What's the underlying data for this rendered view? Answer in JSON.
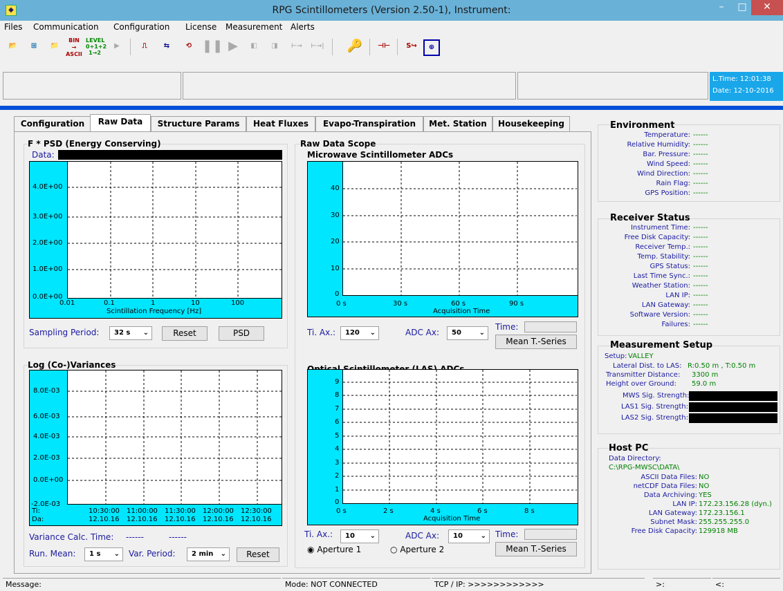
{
  "window": {
    "title": "RPG Scintillometers (Version 2.50-1), Instrument:",
    "minimize": "–",
    "maximize": "□",
    "close": "✕"
  },
  "menu": [
    "Files",
    "Communication",
    "Configuration",
    "License",
    "Measurement",
    "Alerts"
  ],
  "toolbar": {
    "bin_ascii": "BIN\nASCII",
    "level": "LEVEL\n0+1+2\n1→2"
  },
  "clock": {
    "time": "L.Time: 12:01:38",
    "date": "Date: 12-10-2016"
  },
  "tabs": [
    "Configuration",
    "Raw Data",
    "Structure Params",
    "Heat Fluxes",
    "Evapo-Transpiration",
    "Met. Station",
    "Housekeeping"
  ],
  "psd": {
    "title": "F * PSD (Energy Conserving)",
    "data_label": "Data:",
    "y_ticks": [
      "4.0E+00",
      "3.0E+00",
      "2.0E+00",
      "1.0E+00",
      "0.0E+00"
    ],
    "x_ticks": [
      "0.01",
      "0.1",
      "1",
      "10",
      "100"
    ],
    "xlabel": "Scintillation Frequency [Hz]",
    "sampling_label": "Sampling Period:",
    "sampling_value": "32 s",
    "reset": "Reset",
    "psd_button": "PSD"
  },
  "scope": {
    "title": "Raw Data Scope",
    "mw_title": "Microwave Scintillometer ADCs",
    "mw_y_ticks": [
      "40",
      "30",
      "20",
      "10",
      "0"
    ],
    "mw_x_ticks": [
      "0 s",
      "30 s",
      "60 s",
      "90 s"
    ],
    "xlabel": "Acquisition Time",
    "ti_ax_label": "Ti. Ax.:",
    "mw_ti_value": "120",
    "adc_ax_label": "ADC Ax:",
    "mw_adc_value": "50",
    "time_label": "Time:",
    "mean_button": "Mean T.-Series",
    "las_title": "Optical Scintillometer (LAS) ADCs",
    "las_y_ticks": [
      "9",
      "8",
      "7",
      "6",
      "5",
      "4",
      "3",
      "2",
      "1",
      "0"
    ],
    "las_x_ticks": [
      "0 s",
      "2 s",
      "4 s",
      "6 s",
      "8 s"
    ],
    "las_ti_value": "10",
    "las_adc_value": "10",
    "aperture1": "Aperture 1",
    "aperture2": "Aperture 2"
  },
  "logvar": {
    "title": "Log (Co-)Variances",
    "y_ticks": [
      "8.0E-03",
      "6.0E-03",
      "4.0E-03",
      "2.0E-03",
      "0.0E+00",
      "-2.0E-03"
    ],
    "ti_label": "Ti:",
    "da_label": "Da:",
    "x_times": [
      "10:30:00",
      "11:00:00",
      "11:30:00",
      "12:00:00",
      "12:30:00"
    ],
    "x_dates": [
      "12.10.16",
      "12.10.16",
      "12.10.16",
      "12.10.16",
      "12.10.16"
    ],
    "calc_label": "Variance Calc. Time:",
    "calc_value1": "------",
    "calc_value2": "------",
    "run_mean_label": "Run. Mean:",
    "run_mean_value": "1 s",
    "var_period_label": "Var. Period:",
    "var_period_value": "2 min",
    "reset": "Reset"
  },
  "environment": {
    "title": "Environment",
    "rows": [
      {
        "k": "Temperature:",
        "v": "------"
      },
      {
        "k": "Relative Humidity:",
        "v": "------"
      },
      {
        "k": "Bar. Pressure:",
        "v": "------"
      },
      {
        "k": "Wind Speed:",
        "v": "------"
      },
      {
        "k": "Wind Direction:",
        "v": "------"
      },
      {
        "k": "Rain Flag:",
        "v": "------"
      },
      {
        "k": "GPS Position:",
        "v": "------"
      }
    ]
  },
  "receiver": {
    "title": "Receiver Status",
    "rows": [
      {
        "k": "Instrument Time:",
        "v": "------"
      },
      {
        "k": "Free Disk Capacity:",
        "v": "------"
      },
      {
        "k": "Receiver Temp.:",
        "v": "------"
      },
      {
        "k": "Temp. Stability:",
        "v": "------"
      },
      {
        "k": "GPS Status:",
        "v": "------"
      },
      {
        "k": "Last Time Sync.:",
        "v": "------"
      },
      {
        "k": "Weather Station:",
        "v": "------"
      },
      {
        "k": "LAN IP:",
        "v": "------"
      },
      {
        "k": "LAN Gateway:",
        "v": "------"
      },
      {
        "k": "Software Version:",
        "v": "------"
      },
      {
        "k": "Failures:",
        "v": "------"
      }
    ]
  },
  "setup": {
    "title": "Measurement Setup",
    "setup_label": "Setup:",
    "setup_value": "VALLEY",
    "lat_label": "Lateral Dist. to LAS:",
    "lat_value": "R:0.50 m , T:0.50 m",
    "tx_label": "Transmitter Distance:",
    "tx_value": "3300 m",
    "height_label": "Height over Ground:",
    "height_value": "59.0 m",
    "mws_label": "MWS Sig. Strength:",
    "las1_label": "LAS1 Sig. Strength:",
    "las2_label": "LAS2 Sig. Strength:"
  },
  "host": {
    "title": "Host PC",
    "dir_label": "Data Directory:",
    "dir_value": "C:\\RPG-MWSC\\DATA\\",
    "rows": [
      {
        "k": "ASCII Data Files:",
        "v": "NO"
      },
      {
        "k": "netCDF Data Files:",
        "v": "NO"
      },
      {
        "k": "Data Archiving:",
        "v": "YES"
      },
      {
        "k": "LAN IP:",
        "v": "172.23.156.28 (dyn.)"
      },
      {
        "k": "LAN Gateway:",
        "v": "172.23.156.1"
      },
      {
        "k": "Subnet Mask:",
        "v": "255.255.255.0"
      },
      {
        "k": "Free Disk Capacity:",
        "v": "129918 MB"
      }
    ]
  },
  "status": {
    "message": "Message:",
    "mode": "Mode: NOT CONNECTED",
    "tcp": "TCP / IP:  >>>>>>>>>>>>",
    "gt": ">:",
    "lt": "<:"
  }
}
